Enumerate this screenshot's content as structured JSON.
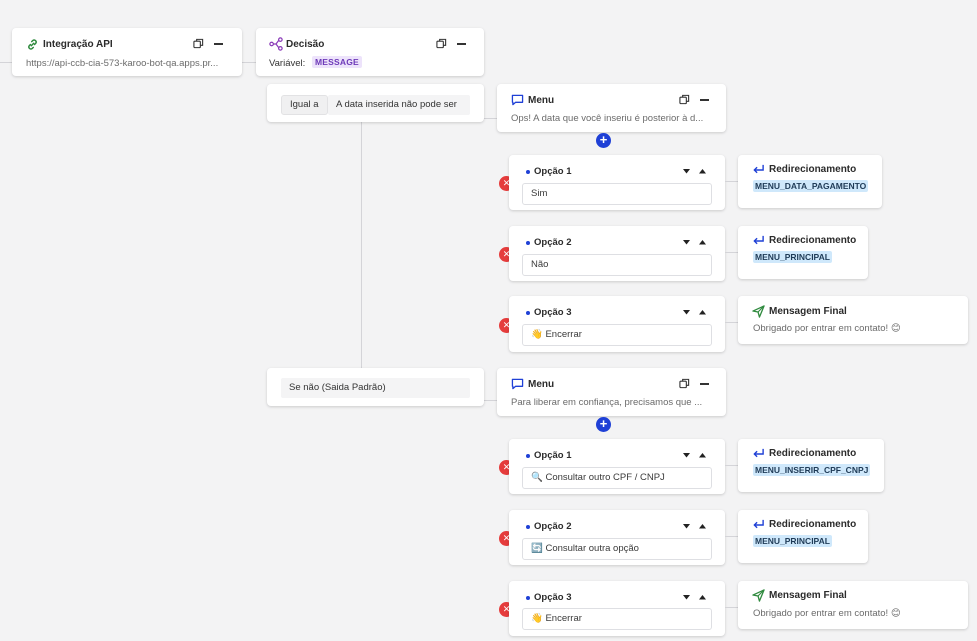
{
  "api_node": {
    "title": "Integração API",
    "url": "https://api-ccb-cia-573-karoo-bot-qa.apps.pr..."
  },
  "decision_node": {
    "title": "Decisão",
    "variable_label": "Variável:",
    "variable_value": "MESSAGE"
  },
  "conditions": [
    {
      "label": "Igual a",
      "value": "A data inserida não pode ser"
    },
    {
      "value": "Se não (Saida Padrão)"
    }
  ],
  "menus": [
    {
      "title": "Menu",
      "message": "Ops! A data que você inseriu é posterior à d...",
      "options": [
        {
          "title": "Opção 1",
          "value": "Sim",
          "target_type": "Redirecionamento",
          "target_value": "MENU_DATA_PAGAMENTO"
        },
        {
          "title": "Opção 2",
          "value": "Não",
          "target_type": "Redirecionamento",
          "target_value": "MENU_PRINCIPAL"
        },
        {
          "title": "Opção 3",
          "value": "👋 Encerrar",
          "target_type": "Mensagem Final",
          "target_value": "Obrigado por entrar em contato! 😊"
        }
      ]
    },
    {
      "title": "Menu",
      "message": "Para liberar em confiança, precisamos que ...",
      "options": [
        {
          "title": "Opção 1",
          "value": "🔍 Consultar outro CPF / CNPJ",
          "target_type": "Redirecionamento",
          "target_value": "MENU_INSERIR_CPF_CNPJ"
        },
        {
          "title": "Opção 2",
          "value": "🔄 Consultar outra opção",
          "target_type": "Redirecionamento",
          "target_value": "MENU_PRINCIPAL"
        },
        {
          "title": "Opção 3",
          "value": "👋 Encerrar",
          "target_type": "Mensagem Final",
          "target_value": "Obrigado por entrar em contato! 😊"
        }
      ]
    }
  ],
  "colors": {
    "accent_blue": "#1f40d6",
    "delete_red": "#e53c3c",
    "variable_badge": "#ede3fb",
    "target_badge": "#cfe8fb",
    "link_green": "#2f8a3e",
    "send_green": "#2f8a3e"
  },
  "icons": {
    "api": "link-icon",
    "decision": "branch-icon",
    "menu": "chat-icon",
    "redirect": "redirect-arrow-icon",
    "final": "send-icon",
    "duplicate": "copy-icon",
    "collapse": "minus-icon",
    "add": "plus-icon",
    "delete": "close-icon",
    "move_down": "caret-down-icon",
    "move_up": "caret-up-icon"
  }
}
